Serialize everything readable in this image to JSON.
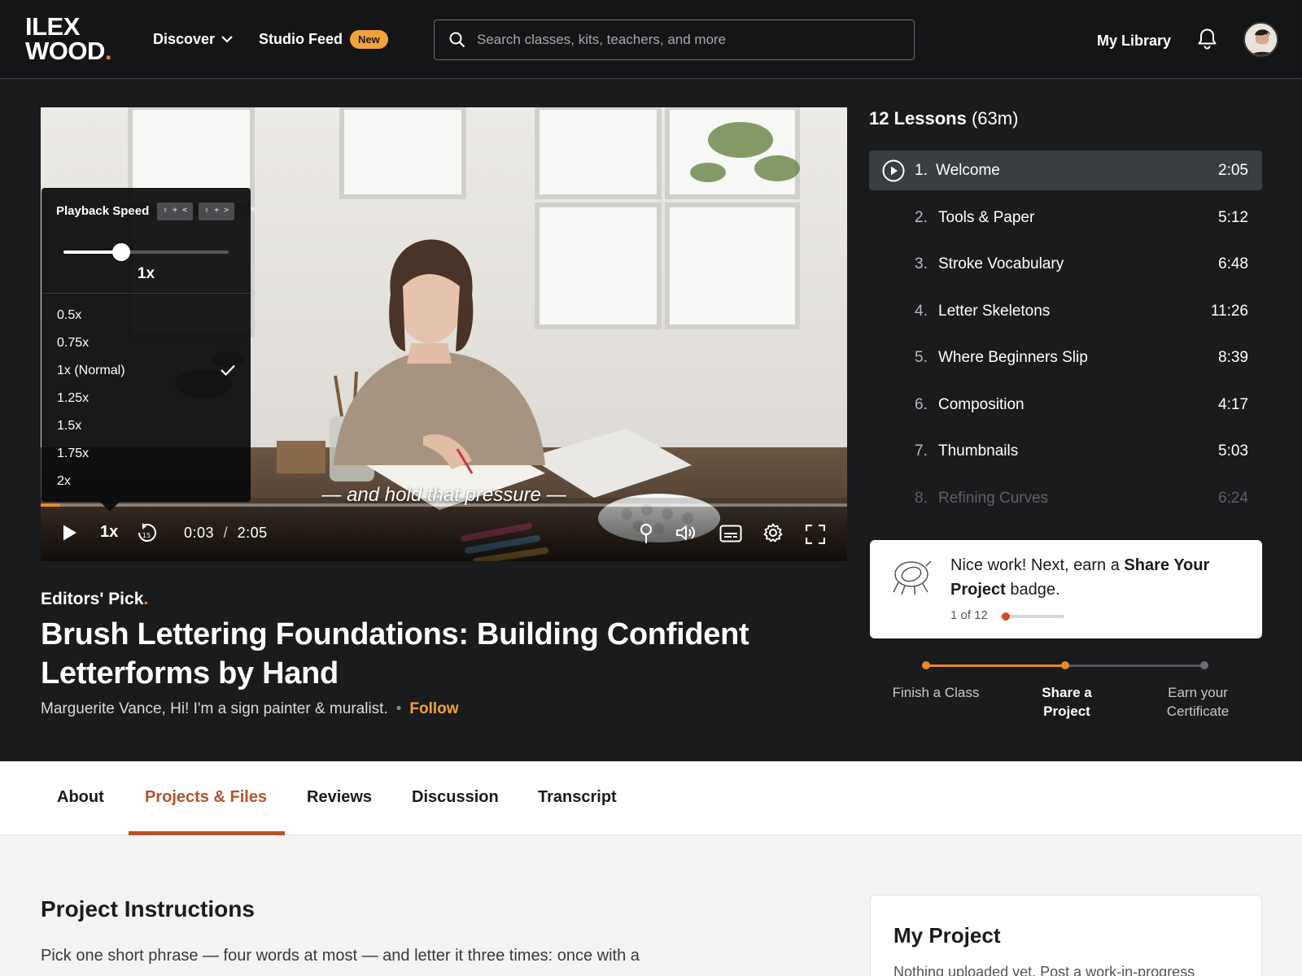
{
  "nav": {
    "logo_line1": "ILEX",
    "logo_line2": "WOOD",
    "logo_dot": ".",
    "discover_label": "Discover",
    "studio_feed_label": "Studio Feed",
    "new_badge": "New",
    "search_placeholder": "Search classes, kits, teachers, and more",
    "my_library_label": "My Library",
    "icons": [
      "chevron-down-icon",
      "search-icon",
      "bell-icon"
    ]
  },
  "player": {
    "caption": "— and hold that pressure —",
    "speed_button": "1x",
    "current_time": "0:03",
    "time_separator": "/",
    "duration": "2:05",
    "progress_fraction": 0.024,
    "speed_menu": {
      "title": "Playback Speed",
      "shortcut_slower": "⇧ + <",
      "shortcut_faster": "⇧ + >",
      "current": "1x",
      "slider_fraction": 0.35,
      "options": [
        "0.5x",
        "0.75x",
        "1x (Normal)",
        "1.25x",
        "1.5x",
        "1.75x",
        "2x"
      ],
      "selected_option": "1x (Normal)"
    },
    "control_icons": [
      "play-icon",
      "rewind-15-icon",
      "bookmark-pin-icon",
      "volume-icon",
      "captions-icon",
      "settings-gear-icon",
      "fullscreen-icon"
    ]
  },
  "course": {
    "editors_pick": "Editors' Pick",
    "editors_dot": ".",
    "title": "Brush Lettering Foundations: Building Confident Letterforms by Hand",
    "teacher": "Marguerite Vance, Hi! I'm a sign painter & muralist.",
    "separator": "•",
    "follow_label": "Follow"
  },
  "lessons": {
    "count_label": "12 Lessons",
    "total_duration": "(63m)",
    "items": [
      {
        "num": "1.",
        "title": "Welcome",
        "duration": "2:05",
        "active": true
      },
      {
        "num": "2.",
        "title": "Tools & Paper",
        "duration": "5:12"
      },
      {
        "num": "3.",
        "title": "Stroke Vocabulary",
        "duration": "6:48"
      },
      {
        "num": "4.",
        "title": "Letter Skeletons",
        "duration": "11:26"
      },
      {
        "num": "5.",
        "title": "Where Beginners Slip",
        "duration": "8:39"
      },
      {
        "num": "6.",
        "title": "Composition",
        "duration": "4:17"
      },
      {
        "num": "7.",
        "title": "Thumbnails",
        "duration": "5:03"
      },
      {
        "num": "8.",
        "title": "Refining Curves",
        "duration": "6:24"
      }
    ]
  },
  "badge": {
    "text_prefix": "Nice work! Next, earn a ",
    "badge_name": "Share Your Project",
    "text_suffix": " badge.",
    "count": "1 of 12",
    "progress_fraction": 0.083
  },
  "steps": [
    {
      "label": "Finish a Class",
      "state": "done"
    },
    {
      "label": "Share a Project",
      "state": "current"
    },
    {
      "label": "Earn your Certificate",
      "state": "upcoming"
    }
  ],
  "tabs": {
    "about": "About",
    "projects": "Projects & Files",
    "reviews": "Reviews",
    "discussion": "Discussion",
    "transcript": "Transcript",
    "active": "Projects & Files"
  },
  "project": {
    "heading": "Project Instructions",
    "text": "Pick one short phrase — four words at most — and letter it three times: once with a",
    "my_project_title": "My Project",
    "my_project_text": "Nothing uploaded yet. Post a work-in-progress"
  },
  "colors": {
    "accent_orange": "#e8892a",
    "badge_new": "#f2a33a",
    "tab_active": "#b5532a",
    "badge_progress": "#d24a27"
  }
}
